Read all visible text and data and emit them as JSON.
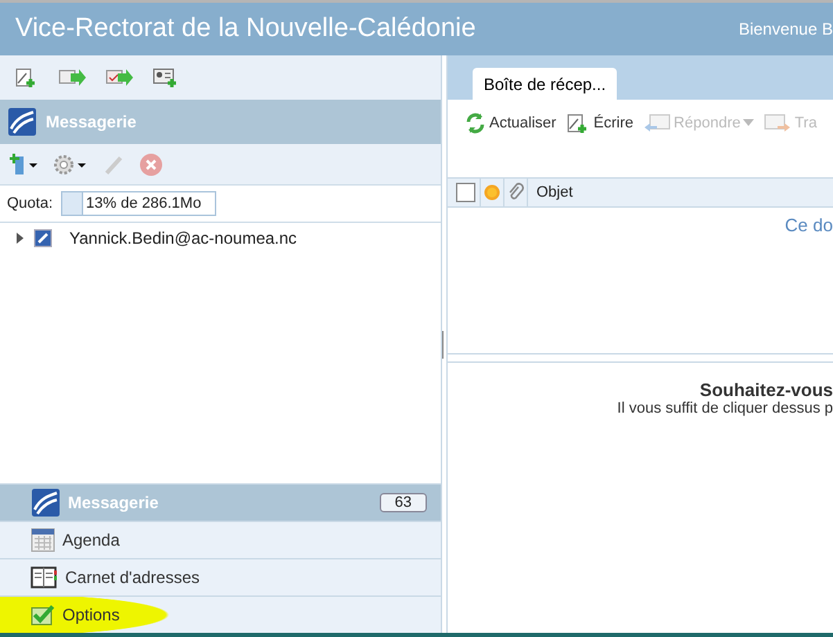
{
  "header": {
    "title": "Vice-Rectorat de la Nouvelle-Calédonie",
    "welcome": "Bienvenue B"
  },
  "left": {
    "section_title": "Messagerie",
    "quota_label": "Quota:",
    "quota": {
      "level": 0.13,
      "text": "13% de 286.1Mo"
    },
    "tree": [
      {
        "label": "Yannick.Bedin@ac-noumea.nc",
        "expanded": false
      }
    ],
    "nav": [
      {
        "label": "Messagerie",
        "kind": "mail",
        "selected": true,
        "count": "63",
        "highlighted": false
      },
      {
        "label": "Agenda",
        "kind": "calendar",
        "selected": false,
        "highlighted": false
      },
      {
        "label": "Carnet d'adresses",
        "kind": "contacts",
        "selected": false,
        "highlighted": false
      },
      {
        "label": "Options",
        "kind": "options",
        "selected": false,
        "highlighted": true
      }
    ]
  },
  "right": {
    "tabs": [
      {
        "label": "Boîte de récep...",
        "selected": true
      }
    ],
    "toolbar": [
      {
        "label": "Actualiser",
        "kind": "refresh",
        "disabled": false,
        "dropdown": false
      },
      {
        "label": "Écrire",
        "kind": "compose",
        "disabled": false,
        "dropdown": false
      },
      {
        "label": "Répondre",
        "kind": "reply",
        "disabled": true,
        "dropdown": true
      },
      {
        "label": "Tra",
        "kind": "forward",
        "disabled": true,
        "dropdown": false
      }
    ],
    "select_all": {
      "checked": false
    },
    "columns": [
      {
        "label": "Objet"
      }
    ],
    "empty_text": "Ce do",
    "preview_title": "Souhaitez-vous",
    "preview_text": "Il vous suffit de cliquer dessus p"
  }
}
